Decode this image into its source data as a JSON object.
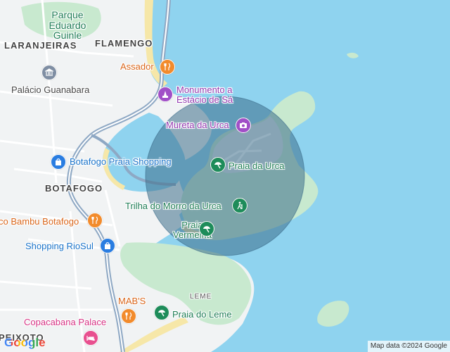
{
  "map": {
    "area_labels": {
      "laranjeiras": "LARANJEIRAS",
      "flamengo": "FLAMENGO",
      "botafogo": "BOTAFOGO",
      "leme": "LEME",
      "peixoto": "PEIXOTO"
    },
    "parks": {
      "parque_eduardo_guinle": [
        "Parque",
        "Eduardo",
        "Guinle"
      ]
    },
    "places": {
      "assador": "Assador",
      "monumento": [
        "Monumento a",
        "Estácio de Sá"
      ],
      "mureta_da_urca": "Mureta da Urca",
      "praia_da_urca": "Praia da Urca",
      "palacio_guanabara": "Palácio Guanabara",
      "botafogo_praia_shopping": "Botafogo Praia Shopping",
      "trilha_morro_da_urca": "Trilha do Morro da Urca",
      "praia_vermelha": [
        "Praia",
        "Vermelha"
      ],
      "coco_bambu": "co Bambu Botafogo",
      "shopping_riosul": "Shopping RioSul",
      "mabs": "MAB'S",
      "praia_do_leme": "Praia do Leme",
      "copacabana_palace": "Copacabana Palace"
    },
    "icons": {
      "assador": "restaurant-icon",
      "monumento": "monument-icon",
      "mureta_da_urca": "camera-icon",
      "praia_da_urca": "beach-umbrella-icon",
      "palacio_guanabara": "landmark-icon",
      "botafogo_praia_shopping": "shopping-bag-icon",
      "trilha_morro_da_urca": "hiking-icon",
      "praia_vermelha": "beach-umbrella-icon",
      "coco_bambu": "restaurant-icon",
      "shopping_riosul": "shopping-bag-icon",
      "mabs": "restaurant-icon",
      "praia_do_leme": "beach-umbrella-icon",
      "copacabana_palace": "hotel-icon"
    },
    "colors": {
      "water": "#8fd3ef",
      "land": "#f1f3f4",
      "park": "#c8e9cf",
      "sand": "#f6e7a8",
      "highway": "#8ea8c4",
      "road": "#ffffff",
      "radius_circle": "#3c6d8a",
      "restaurant": "#f28b2c",
      "attraction": "#a14fc7",
      "beach": "#1e8c5a",
      "shopping": "#2a7de1"
    }
  },
  "branding": {
    "logo": "Google",
    "attribution": "Map data ©2024 Google"
  }
}
